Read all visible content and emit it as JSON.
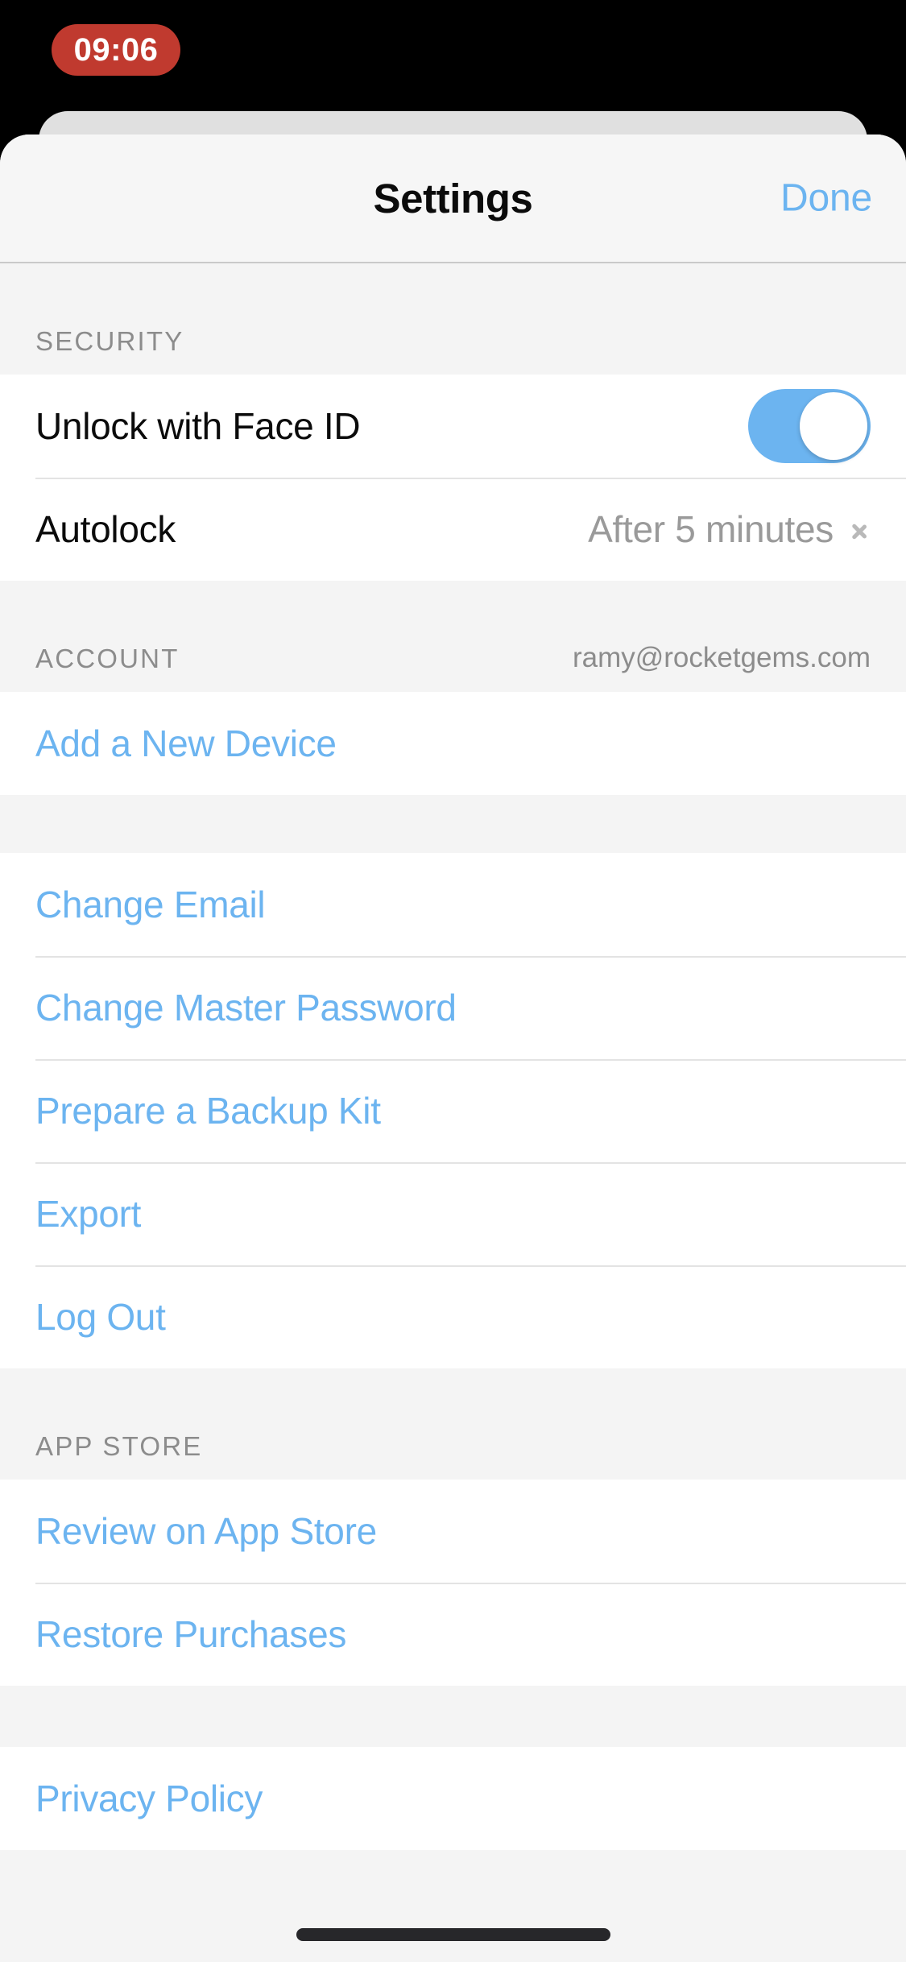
{
  "status_bar": {
    "recording_time": "09:06"
  },
  "navbar": {
    "title": "Settings",
    "done_label": "Done"
  },
  "sections": {
    "security": {
      "header": "SECURITY",
      "face_id": {
        "label": "Unlock with Face ID",
        "toggle_state": "on"
      },
      "autolock": {
        "label": "Autolock",
        "value": "After 5 minutes"
      }
    },
    "account": {
      "header": "ACCOUNT",
      "email": "ramy@rocketgems.com",
      "add_device_label": "Add a New Device",
      "actions": [
        {
          "label": "Change Email"
        },
        {
          "label": "Change Master Password"
        },
        {
          "label": "Prepare a Backup Kit"
        },
        {
          "label": "Export"
        },
        {
          "label": "Log Out"
        }
      ]
    },
    "app_store": {
      "header": "APP STORE",
      "items": [
        {
          "label": "Review on App Store"
        },
        {
          "label": "Restore Purchases"
        }
      ]
    },
    "legal": {
      "items": [
        {
          "label": "Privacy Policy"
        }
      ]
    }
  },
  "colors": {
    "accent": "#6cb4f0",
    "text_primary": "#0b0b0b",
    "text_secondary": "#8c8c8c",
    "value_text": "#9a9a9a",
    "group_bg": "#ffffff",
    "page_bg": "#f4f4f4",
    "recording_pill": "#c03a2f",
    "separator": "#e3e3e3"
  }
}
